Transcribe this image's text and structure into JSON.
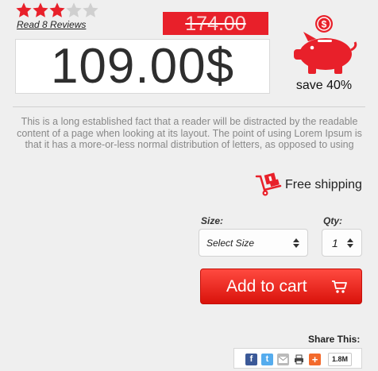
{
  "rating": {
    "value": 3,
    "max": 5,
    "filled_color": "#e8202a",
    "empty_color": "#cfcfcf"
  },
  "reviews_link": "Read 8 Reviews",
  "pricing": {
    "old_price": "174.00",
    "current_price": "109.00$",
    "savings": "save 40%",
    "accent_color": "#e8202a"
  },
  "piggy_icon": "piggy-bank-icon",
  "description": "This is a long established fact that a reader will be distracted by the readable content of a page when looking at its layout. The point of using Lorem Ipsum is that it has a more-or-less normal distribution of letters, as opposed to using",
  "shipping": {
    "icon": "hand-truck-icon",
    "label": "Free shipping"
  },
  "size": {
    "label": "Size:",
    "selected": "Select Size"
  },
  "qty": {
    "label": "Qty:",
    "selected": "1"
  },
  "cart_button": {
    "label": "Add to cart",
    "icon": "cart-icon"
  },
  "share": {
    "title": "Share This:",
    "icons": [
      "facebook-icon",
      "twitter-icon",
      "email-icon",
      "print-icon",
      "plus-icon"
    ],
    "count": "1.8M"
  }
}
